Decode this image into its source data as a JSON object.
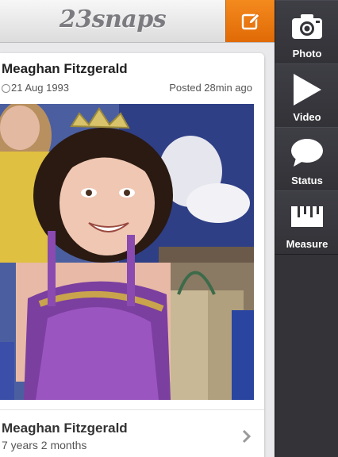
{
  "header": {
    "logo_text": "23snaps",
    "compose_icon": "compose-icon"
  },
  "card": {
    "name": "Meaghan Fitzgerald",
    "date": "21 Aug 1993",
    "posted": "Posted 28min ago",
    "footer_name": "Meaghan Fitzgerald",
    "footer_age": "7 years 2 months"
  },
  "toolbar": {
    "items": [
      {
        "label": "Photo",
        "icon": "camera-icon"
      },
      {
        "label": "Video",
        "icon": "play-icon"
      },
      {
        "label": "Status",
        "icon": "speech-bubble-icon"
      },
      {
        "label": "Measure",
        "icon": "ruler-icon"
      }
    ]
  },
  "colors": {
    "accent": "#e8750f",
    "toolbar_bg": "#333338",
    "page_bg": "#e9e9eb"
  }
}
